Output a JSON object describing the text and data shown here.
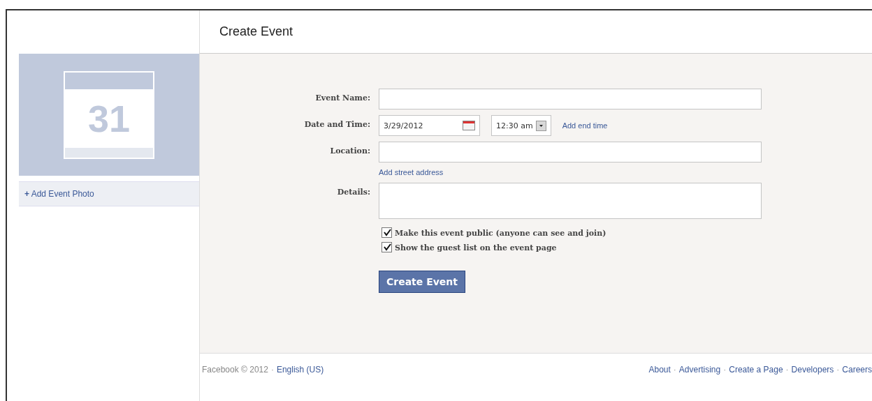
{
  "header": {
    "title": "Create Event"
  },
  "sidebar": {
    "calendar_day": "31",
    "add_photo": {
      "icon": "+",
      "label": "Add Event Photo"
    }
  },
  "form": {
    "fields": [
      {
        "kind": "text",
        "label": "Event Name:"
      },
      {
        "kind": "datetime",
        "label": "Date and Time:",
        "date": "3/29/2012",
        "time": "12:30 am",
        "link": "Add end time"
      },
      {
        "kind": "text",
        "label": "Location:",
        "link": "Add street address"
      },
      {
        "kind": "textarea",
        "label": "Details:"
      }
    ],
    "options": [
      {
        "label": "Make this event public (anyone can see and join)",
        "checked": true
      },
      {
        "label": "Show the guest list on the event page",
        "checked": true
      }
    ],
    "submit": "Create Event"
  },
  "footer": {
    "separator": "·",
    "left": [
      {
        "kind": "text",
        "text": "Facebook © 2012"
      },
      {
        "kind": "link",
        "text": "English (US)"
      }
    ],
    "right": [
      "About",
      "Advertising",
      "Create a Page",
      "Developers",
      "Careers"
    ]
  }
}
